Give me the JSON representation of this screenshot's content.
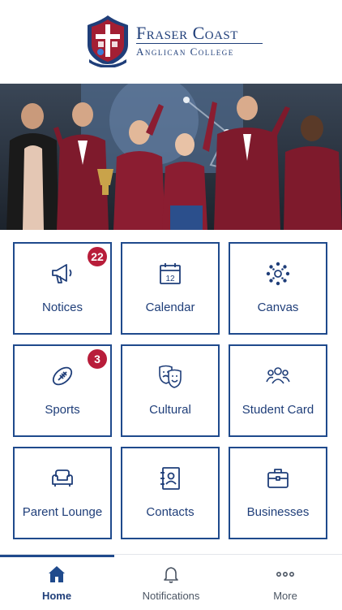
{
  "header": {
    "crest_icon": "school-crest-icon",
    "name_line1": "Fraser Coast",
    "name_line2": "Anglican College"
  },
  "hero": {
    "icon": "students-celebration-photo"
  },
  "tiles": [
    {
      "label": "Notices",
      "icon": "megaphone-icon",
      "badge": "22"
    },
    {
      "label": "Calendar",
      "icon": "calendar-icon",
      "icon_text": "12"
    },
    {
      "label": "Canvas",
      "icon": "canvas-icon"
    },
    {
      "label": "Sports",
      "icon": "football-icon",
      "badge": "3"
    },
    {
      "label": "Cultural",
      "icon": "theatre-masks-icon"
    },
    {
      "label": "Student Card",
      "icon": "people-group-icon"
    },
    {
      "label": "Parent Lounge",
      "icon": "armchair-icon"
    },
    {
      "label": "Contacts",
      "icon": "address-book-icon"
    },
    {
      "label": "Businesses",
      "icon": "briefcase-icon"
    }
  ],
  "tabbar": {
    "tabs": [
      {
        "label": "Home",
        "icon": "home-icon",
        "active": true
      },
      {
        "label": "Notifications",
        "icon": "bell-icon",
        "active": false
      },
      {
        "label": "More",
        "icon": "more-dots-icon",
        "active": false
      }
    ]
  },
  "colors": {
    "primary": "#1f3e79",
    "tile_border": "#1f4a8c",
    "badge": "#b81d3a",
    "crest_red": "#a31f34"
  }
}
